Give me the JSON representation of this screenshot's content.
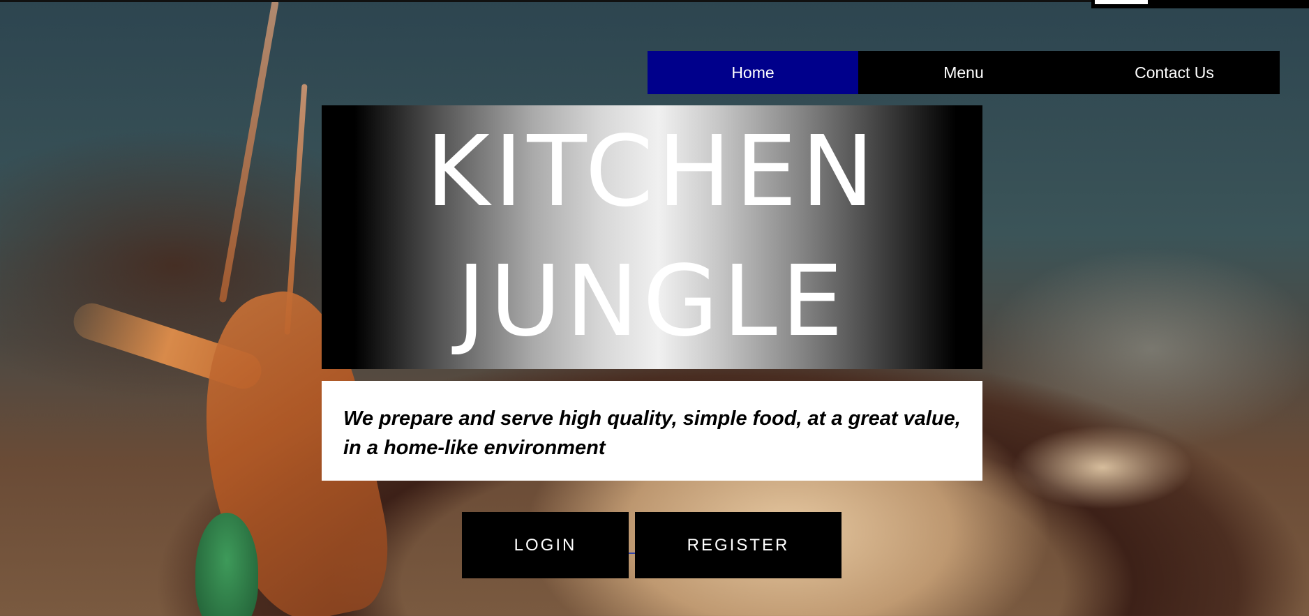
{
  "nav": {
    "items": [
      {
        "label": "Home",
        "active": true
      },
      {
        "label": "Menu",
        "active": false
      },
      {
        "label": "Contact Us",
        "active": false
      }
    ]
  },
  "hero": {
    "line1": "KITCHEN",
    "line2": "JUNGLE"
  },
  "tagline": "We prepare and serve high quality, simple food, at a great value, in a home-like environment",
  "buttons": {
    "login": "LOGIN",
    "register": "REGISTER"
  },
  "colors": {
    "nav_active": "#00008b",
    "nav_background": "#000000",
    "button_background": "#000000",
    "button_text": "#ffffff"
  },
  "background": {
    "image": "food-photo-shrimp-bowl"
  }
}
